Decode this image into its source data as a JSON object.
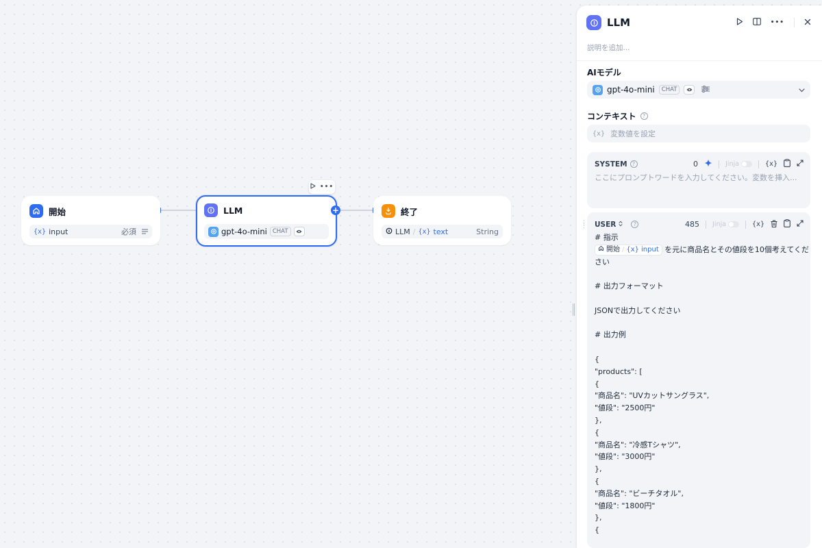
{
  "nodes": {
    "start": {
      "title": "開始",
      "var_icon": "{x}",
      "var_name": "input",
      "required_label": "必須",
      "icon": "home-icon",
      "color": "#2f6bf1"
    },
    "llm": {
      "title": "LLM",
      "model": "gpt-4o-mini",
      "mode_badge": "CHAT",
      "icon": "llm-icon",
      "color": "#6172f3"
    },
    "end": {
      "title": "終了",
      "source_node": "LLM",
      "var_icon": "{x}",
      "var_name": "text",
      "var_type": "String",
      "icon": "end-icon",
      "color": "#f79009"
    }
  },
  "panel": {
    "title": "LLM",
    "description_placeholder": "説明を追加...",
    "model_section_label": "AIモデル",
    "model_name": "gpt-4o-mini",
    "model_mode": "CHAT",
    "context_label": "コンテキスト",
    "context_placeholder": "変数値を設定",
    "system": {
      "role": "SYSTEM",
      "count": "0",
      "jinja": "Jinja",
      "var_symbol": "{x}",
      "placeholder": "ここにプロンプトワードを入力してください。変数を挿入..."
    },
    "user": {
      "role": "USER",
      "count": "485",
      "jinja": "Jinja",
      "var_symbol": "{x}",
      "line_1": "# 指示",
      "ref_node": "開始",
      "ref_var": "input",
      "line_2_rest": "を元に商品名とその値段を10個考えてくだ",
      "line_3": "さい",
      "lines": [
        "",
        "# 出力フォーマット",
        "",
        "JSONで出力してください",
        "",
        "# 出力例",
        "",
        "{",
        "\"products\": [",
        "{",
        "\"商品名\": \"UVカットサングラス\",",
        "\"値段\": \"2500円\"",
        "},",
        "{",
        "\"商品名\": \"冷感Tシャツ\",",
        "\"値段\": \"3000円\"",
        "},",
        "{",
        "\"商品名\": \"ビーチタオル\",",
        "\"値段\": \"1800円\"",
        "},",
        "{"
      ]
    }
  },
  "colors": {
    "accent": "#2f6bf1",
    "llm": "#6172f3",
    "end": "#f79009",
    "gpt": "#55a3f0"
  }
}
